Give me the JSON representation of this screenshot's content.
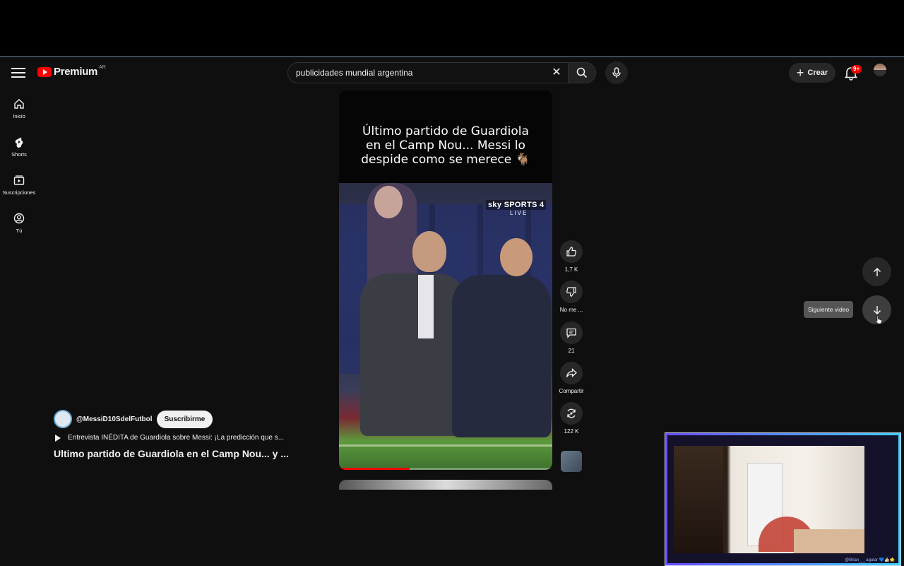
{
  "header": {
    "logo_text": "Premium",
    "logo_country": "AR",
    "search_value": "publicidades mundial argentina",
    "create_label": "Crear",
    "notifications_badge": "9+"
  },
  "sidebar": {
    "items": [
      {
        "label": "Inicio",
        "icon": "home-icon"
      },
      {
        "label": "Shorts",
        "icon": "shorts-icon"
      },
      {
        "label": "Suscripciones",
        "icon": "subscriptions-icon"
      },
      {
        "label": "Tú",
        "icon": "you-icon"
      }
    ]
  },
  "video": {
    "caption_line1": "Último partido de Guardiola",
    "caption_line2": "en el Camp Nou... Messi lo",
    "caption_line3": "despide como se merece 🐐",
    "broadcaster": "sky SPORTS 4",
    "broadcaster_live": "LIVE",
    "progress": 0.33
  },
  "actions": {
    "like_count": "1,7 K",
    "dislike_label": "No me ...",
    "comments_count": "21",
    "share_label": "Compartir",
    "remix_count": "122 K"
  },
  "channel": {
    "handle": "@MessiD10SdelFutbol",
    "subscribe_label": "Suscribirme",
    "related_video": "Entrevista INÉDITA de Guardiola sobre Messi: ¡La predicción que s...",
    "title": "Ultimo partido de Guardiola en el Camp Nou... y ..."
  },
  "navigation": {
    "next_tooltip": "Siguiente video"
  },
  "webcam": {
    "caption": "@Brian___aguiar 💙👍🏻🌟"
  },
  "colors": {
    "background": "#0f0f0f",
    "accent_red": "#ff0000",
    "button_bg": "#272727"
  }
}
